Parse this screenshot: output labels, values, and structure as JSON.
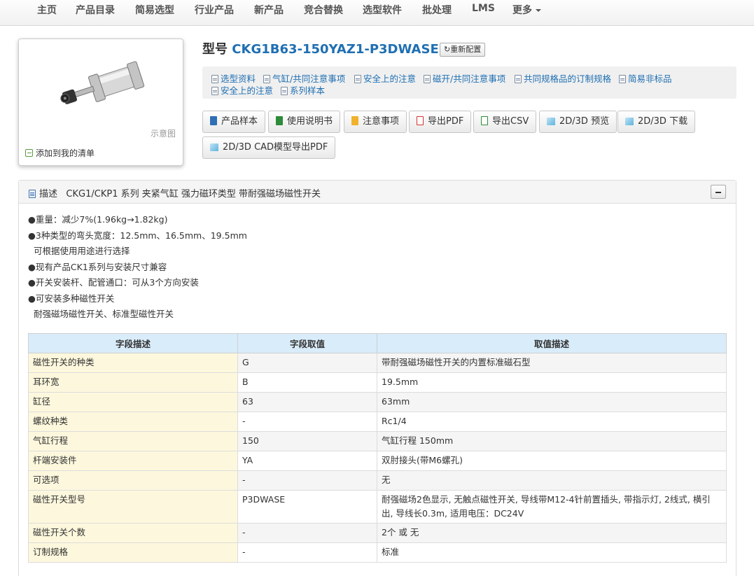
{
  "nav": {
    "items": [
      "主页",
      "产品目录",
      "简易选型",
      "行业产品",
      "新产品",
      "竞合替换",
      "选型软件",
      "批处理",
      "LMS",
      "更多"
    ]
  },
  "image_card": {
    "caption": "示意图",
    "add_to_list": "添加到我的清单"
  },
  "product": {
    "label": "型号",
    "model": "CKG1B63-150YAZ1-P3DWASE",
    "reset_button": "重新配置"
  },
  "doc_links": [
    "选型资料",
    "气缸/共同注意事项",
    "安全上的注意",
    "磁开/共同注意事项",
    "共同规格品的订制规格",
    "简易非标品",
    "安全上的注意",
    "系列样本"
  ],
  "buttons": [
    "产品样本",
    "使用说明书",
    "注意事项",
    "导出PDF",
    "导出CSV",
    "2D/3D 预览",
    "2D/3D 下载",
    "2D/3D CAD模型导出PDF"
  ],
  "description": {
    "header_label": "描述",
    "header_text": "CKG1/CKP1 系列 夹紧气缸 强力磁环类型 带耐强磁场磁性开关",
    "features": [
      "●重量：减少7%(1.96kg→1.82kg)",
      "●3种类型的弯头宽度：12.5mm、16.5mm、19.5mm",
      "  可根据使用用途进行选择",
      "●现有产品CK1系列与安装尺寸兼容",
      "●开关安装杆、配管通口：可从3个方向安装",
      "●可安装多种磁性开关",
      "  耐强磁场磁性开关、标准型磁性开关"
    ]
  },
  "table": {
    "headers": [
      "字段描述",
      "字段取值",
      "取值描述"
    ],
    "rows": [
      [
        "磁性开关的种类",
        "G",
        "带耐强磁场磁性开关的内置标准磁石型"
      ],
      [
        "耳环宽",
        "B",
        "19.5mm"
      ],
      [
        "缸径",
        "63",
        "63mm"
      ],
      [
        "螺纹种类",
        "-",
        "Rc1/4"
      ],
      [
        "气缸行程",
        "150",
        "气缸行程 150mm"
      ],
      [
        "杆端安装件",
        "YA",
        "双肘接头(带M6螺孔)"
      ],
      [
        "可选项",
        "-",
        "无"
      ],
      [
        "磁性开关型号",
        "P3DWASE",
        "耐强磁场2色显示, 无触点磁性开关, 导线带M12-4针前置插头, 带指示灯, 2线式, 横引出, 导线长0.3m, 适用电压：DC24V"
      ],
      [
        "磁性开关个数",
        "-",
        "2个 或 无"
      ],
      [
        "订制规格",
        "-",
        "标准"
      ]
    ]
  }
}
